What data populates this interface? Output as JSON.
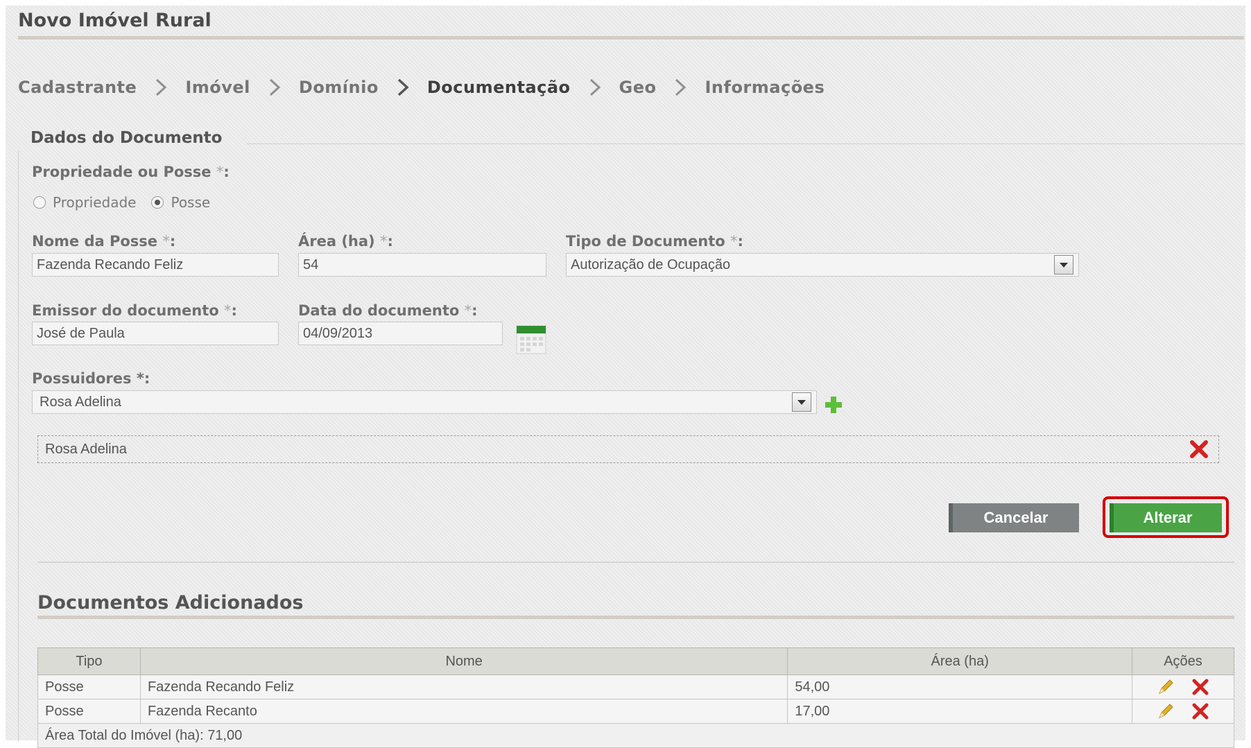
{
  "page": {
    "title": "Novo Imóvel Rural"
  },
  "steps": [
    {
      "label": "Cadastrante",
      "active": false
    },
    {
      "label": "Imóvel",
      "active": false
    },
    {
      "label": "Domínio",
      "active": false
    },
    {
      "label": "Documentação",
      "active": true
    },
    {
      "label": "Geo",
      "active": false
    },
    {
      "label": "Informações",
      "active": false
    }
  ],
  "form": {
    "section_title": "Dados do Documento",
    "required_mark": "*",
    "ownership": {
      "label": "Propriedade ou Posse",
      "options": [
        "Propriedade",
        "Posse"
      ],
      "selected": "Posse"
    },
    "nome_posse": {
      "label": "Nome da Posse",
      "value": "Fazenda Recando Feliz"
    },
    "area": {
      "label": "Área (ha)",
      "value": "54"
    },
    "tipo_documento": {
      "label": "Tipo de Documento",
      "value": "Autorização de Ocupação"
    },
    "emissor": {
      "label": "Emissor do documento",
      "value": "José de Paula"
    },
    "data_documento": {
      "label": "Data do documento",
      "value": "04/09/2013"
    },
    "possuidores": {
      "label": "Possuidores",
      "value": "Rosa Adelina",
      "added": [
        "Rosa Adelina"
      ]
    },
    "buttons": {
      "cancel": "Cancelar",
      "submit": "Alterar"
    }
  },
  "documents": {
    "title": "Documentos Adicionados",
    "columns": [
      "Tipo",
      "Nome",
      "Área (ha)",
      "Ações"
    ],
    "rows": [
      {
        "tipo": "Posse",
        "nome": "Fazenda Recando Feliz",
        "area": "54,00"
      },
      {
        "tipo": "Posse",
        "nome": "Fazenda Recanto",
        "area": "17,00"
      }
    ],
    "total": "Área Total do Imóvel (ha): 71,00"
  },
  "icons": {
    "chevron": "chevron-right-icon",
    "calendar": "calendar-icon",
    "add": "plus-icon",
    "remove": "close-icon",
    "edit": "pencil-icon"
  },
  "colors": {
    "primary_button": "#4aa446",
    "cancel_button": "#7f8383",
    "highlight": "#d40000",
    "delete": "#d42222",
    "add": "#5bbf3a"
  }
}
